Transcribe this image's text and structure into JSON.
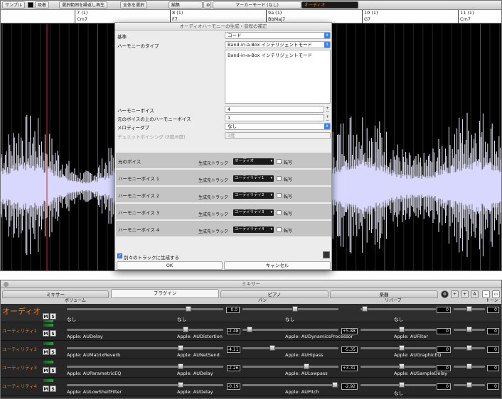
{
  "toolbar": {
    "sample": "サンプル",
    "absorb": "吸着",
    "loop_play": "選択範囲を繰返し再生",
    "select_all": "全体を選択",
    "edit": "編集",
    "marker_mode": "マーカーモード (なし)",
    "track": "オーディオ"
  },
  "ruler": {
    "bars": [
      {
        "num": "7 (1)",
        "chord": "Cm7"
      },
      {
        "num": "8 (1)",
        "chord": "F7"
      },
      {
        "num": "9a (1)",
        "chord": "BbMaj7"
      },
      {
        "num": "10 (1)",
        "chord": "G7"
      },
      {
        "num": "11 (1)",
        "chord": "Cm7"
      }
    ]
  },
  "dialog": {
    "title": "オーディオハーモニーの生成・音程の補正",
    "basis_label": "基準",
    "basis_value": "コード",
    "harmony_type_label": "ハーモニーのタイプ",
    "harmony_type_value": "Band-in-a-Box インテリジェントモード",
    "harmony_type_list": "Band-in-a-Box インテリジェントモード",
    "harmony_voices_label": "ハーモニーボイス",
    "harmony_voices_value": "4",
    "above_label": "元のボイスの上のハーモニーボイス",
    "above_value": "1",
    "melody_dub_label": "メロディーダブ",
    "melody_dub_value": "なし",
    "duet_label": "デュエットボイシング (3度/6度)",
    "duet_value": "3度",
    "rows": [
      {
        "label": "元のボイス",
        "track_label": "生成元トラック",
        "track": "オーディオ",
        "transcribe": "転写"
      },
      {
        "label": "ハーモニーボイス 1",
        "track_label": "生成先トラック",
        "track": "ユーティリティ1",
        "transcribe": "転写"
      },
      {
        "label": "ハーモニーボイス 2",
        "track_label": "生成先トラック",
        "track": "ユーティリティ2",
        "transcribe": "転写"
      },
      {
        "label": "ハーモニーボイス 3",
        "track_label": "生成先トラック",
        "track": "ユーティリティ3",
        "transcribe": "転写"
      },
      {
        "label": "ハーモニーボイス 4",
        "track_label": "生成先トラック",
        "track": "ユーティリティ4",
        "transcribe": "転写"
      }
    ],
    "separate_tracks": "別々のトラックに生成する",
    "ok": "OK",
    "cancel": "キャンセル"
  },
  "mixer": {
    "title": "ミキサー",
    "tabs": [
      "ミキサー",
      "プラグイン",
      "ピアノ",
      "楽器"
    ],
    "icon_buttons": [
      "+",
      "+",
      "A"
    ],
    "columns": {
      "volume": "ボリューム",
      "pan": "パン",
      "reverb": "リバーブ",
      "tone": "トーン"
    },
    "tracks": [
      {
        "name": "オーディオ",
        "m": "M",
        "s": "S",
        "volume": 0.75,
        "pan": "0.0",
        "pan_pos": 0.5,
        "reverb": "0",
        "tone": "0",
        "plugins": [
          "なし",
          "なし",
          "なし",
          "なし"
        ]
      },
      {
        "name": "ユーティリティ1",
        "m": "M",
        "s": "S",
        "volume": 0.73,
        "pan": "-2.48",
        "pan_pos": 0.1,
        "reverb": "0",
        "tone": "0",
        "pan2": "+5.88",
        "plugins": [
          "Apple: AUDelay",
          "Apple: AUDistortion",
          "Apple: AUDynamicsProcessor",
          "Apple: AUFilter"
        ]
      },
      {
        "name": "ユーティリティ2",
        "m": "M",
        "s": "S",
        "volume": 0.7,
        "pan": "-4.11",
        "pan_pos": 0.3,
        "reverb": "0",
        "tone": "0",
        "pan2": "-5.35",
        "plugins": [
          "Apple: AUMatrixReverb",
          "Apple: AUNetSend",
          "Apple: AUHipass",
          "Apple: AUGraphicEQ"
        ]
      },
      {
        "name": "ユーティリティ3",
        "m": "M",
        "s": "S",
        "volume": 0.7,
        "pan": "-2.26",
        "pan_pos": 0.6,
        "reverb": "0",
        "tone": "0",
        "pan2": "+3.31",
        "plugins": [
          "Apple: AUParametricEQ",
          "Apple: AUDelay",
          "Apple: AULowpass",
          "Apple: AUSampleDelay"
        ]
      },
      {
        "name": "ユーティリティ4",
        "m": "M",
        "s": "S",
        "volume": 0.7,
        "pan": "-0.19",
        "pan_pos": 0.85,
        "reverb": "0",
        "tone": "0",
        "pan2": "-2.92",
        "plugins": [
          "Apple: AULowShelfFilter",
          "Apple: AUDelay",
          "Apple: AUPitch",
          "なし"
        ]
      }
    ]
  }
}
